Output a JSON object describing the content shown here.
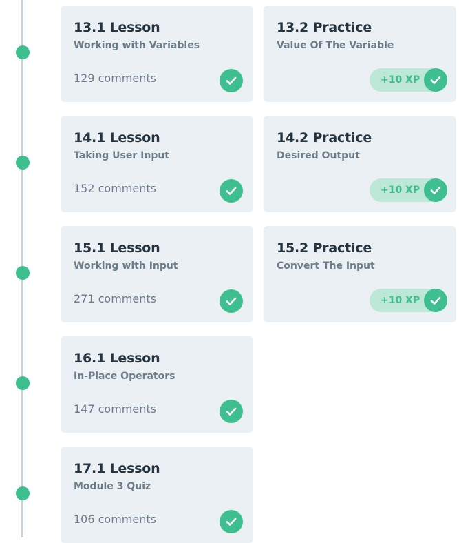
{
  "colors": {
    "accent": "#3fbf8f",
    "accent_light": "#bde8d8",
    "card_bg": "#ebf0f4",
    "timeline": "#c9d3dc",
    "title_text": "#26343f",
    "muted_text": "#6b7c8c"
  },
  "rows": [
    {
      "lesson": {
        "title": "13.1 Lesson",
        "subtitle": "Working with Variables",
        "comments": "129 comments",
        "status_icon": "check-icon"
      },
      "practice": {
        "title": "13.2 Practice",
        "subtitle": "Value Of The Variable",
        "xp": "+10 XP",
        "status_icon": "check-icon"
      }
    },
    {
      "lesson": {
        "title": "14.1 Lesson",
        "subtitle": "Taking User Input",
        "comments": "152 comments",
        "status_icon": "check-icon"
      },
      "practice": {
        "title": "14.2 Practice",
        "subtitle": "Desired Output",
        "xp": "+10 XP",
        "status_icon": "check-icon"
      }
    },
    {
      "lesson": {
        "title": "15.1 Lesson",
        "subtitle": "Working with Input",
        "comments": "271 comments",
        "status_icon": "check-icon"
      },
      "practice": {
        "title": "15.2 Practice",
        "subtitle": "Convert The Input",
        "xp": "+10 XP",
        "status_icon": "check-icon"
      }
    },
    {
      "lesson": {
        "title": "16.1 Lesson",
        "subtitle": "In-Place Operators",
        "comments": "147 comments",
        "status_icon": "check-icon"
      }
    },
    {
      "lesson": {
        "title": "17.1 Lesson",
        "subtitle": "Module 3 Quiz",
        "comments": "106 comments",
        "status_icon": "check-icon"
      }
    }
  ]
}
